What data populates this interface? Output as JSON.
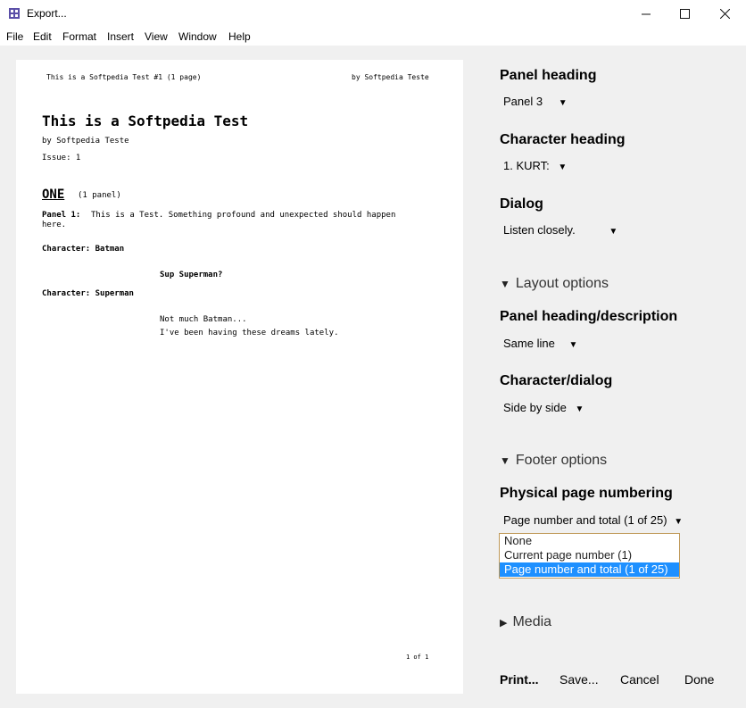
{
  "window": {
    "title": "Export..."
  },
  "menu": [
    "File",
    "Edit",
    "Format",
    "Insert",
    "View",
    "Window",
    "Help"
  ],
  "preview": {
    "header_left": "This is a Softpedia Test #1 (1 page)",
    "header_right": "by Softpedia Teste",
    "doc_title": "This is a Softpedia Test",
    "byline": "by Softpedia Teste",
    "issue": "Issue: 1",
    "page_heading": "ONE",
    "page_sub": "(1 panel)",
    "panel_label": "Panel 1:",
    "panel_text_1": "This is a Test. Something profound and unexpected should happen",
    "panel_text_2": "here.",
    "char1": "Character: Batman",
    "dialog1": "Sup Superman?",
    "char2": "Character: Superman",
    "dialog2_1": "Not much Batman...",
    "dialog2_2": "I've been having these dreams lately.",
    "footer": "1 of 1"
  },
  "options": {
    "panel_heading": {
      "label": "Panel heading",
      "value": "Panel 3"
    },
    "character_heading": {
      "label": "Character heading",
      "value": "1. KURT:"
    },
    "dialog": {
      "label": "Dialog",
      "value": "Listen closely."
    },
    "layout_section": "Layout options",
    "panel_desc": {
      "label": "Panel heading/description",
      "value": "Same line"
    },
    "char_dialog": {
      "label": "Character/dialog",
      "value": "Side by side"
    },
    "footer_section": "Footer options",
    "page_numbering": {
      "label": "Physical page numbering",
      "value": "Page number and total (1 of 25)",
      "options": [
        "None",
        "Current page number (1)",
        "Page number and total (1 of 25)"
      ]
    },
    "media_section": "Media"
  },
  "buttons": {
    "print": "Print...",
    "save": "Save...",
    "cancel": "Cancel",
    "done": "Done"
  },
  "colors": {
    "selection": "#1e90ff",
    "dropdown_border": "#c09a5a"
  }
}
